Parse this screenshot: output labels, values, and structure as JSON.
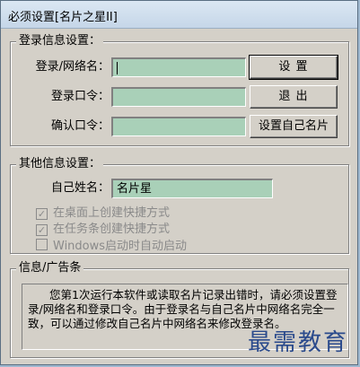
{
  "window": {
    "title": "必须设置[名片之星II]"
  },
  "login_group": {
    "legend": "登录信息设置：",
    "username_label": "登录/网络名：",
    "password_label": "登录口令：",
    "confirm_label": "确认口令：",
    "username_value": "",
    "password_value": "",
    "confirm_value": "",
    "setup_button": "设 置",
    "exit_button": "退 出",
    "set_card_name_button": "设置自己名片"
  },
  "other_group": {
    "legend": "其他信息设置：",
    "name_label": "自己姓名：",
    "name_value": "名片星",
    "checkboxes": [
      {
        "label": "在桌面上创建快捷方式",
        "checked": true
      },
      {
        "label": "在任务条创建快捷方式",
        "checked": true
      },
      {
        "label": "Windows启动时自动启动",
        "checked": false
      }
    ]
  },
  "info_group": {
    "legend": "信息/广告条",
    "text": "您第1次运行本软件或读取名片记录出错时，请必须设置登录/网络名和登录口令。由于登录名与自己名片中网络名完全一致，可以通过修改自己名片中网络名来修改登录名。"
  },
  "watermark": "最需教育",
  "colors": {
    "field_bg": "#a9d0b8",
    "window_bg": "#d4d0c8",
    "watermark": "#2a4a8c"
  }
}
